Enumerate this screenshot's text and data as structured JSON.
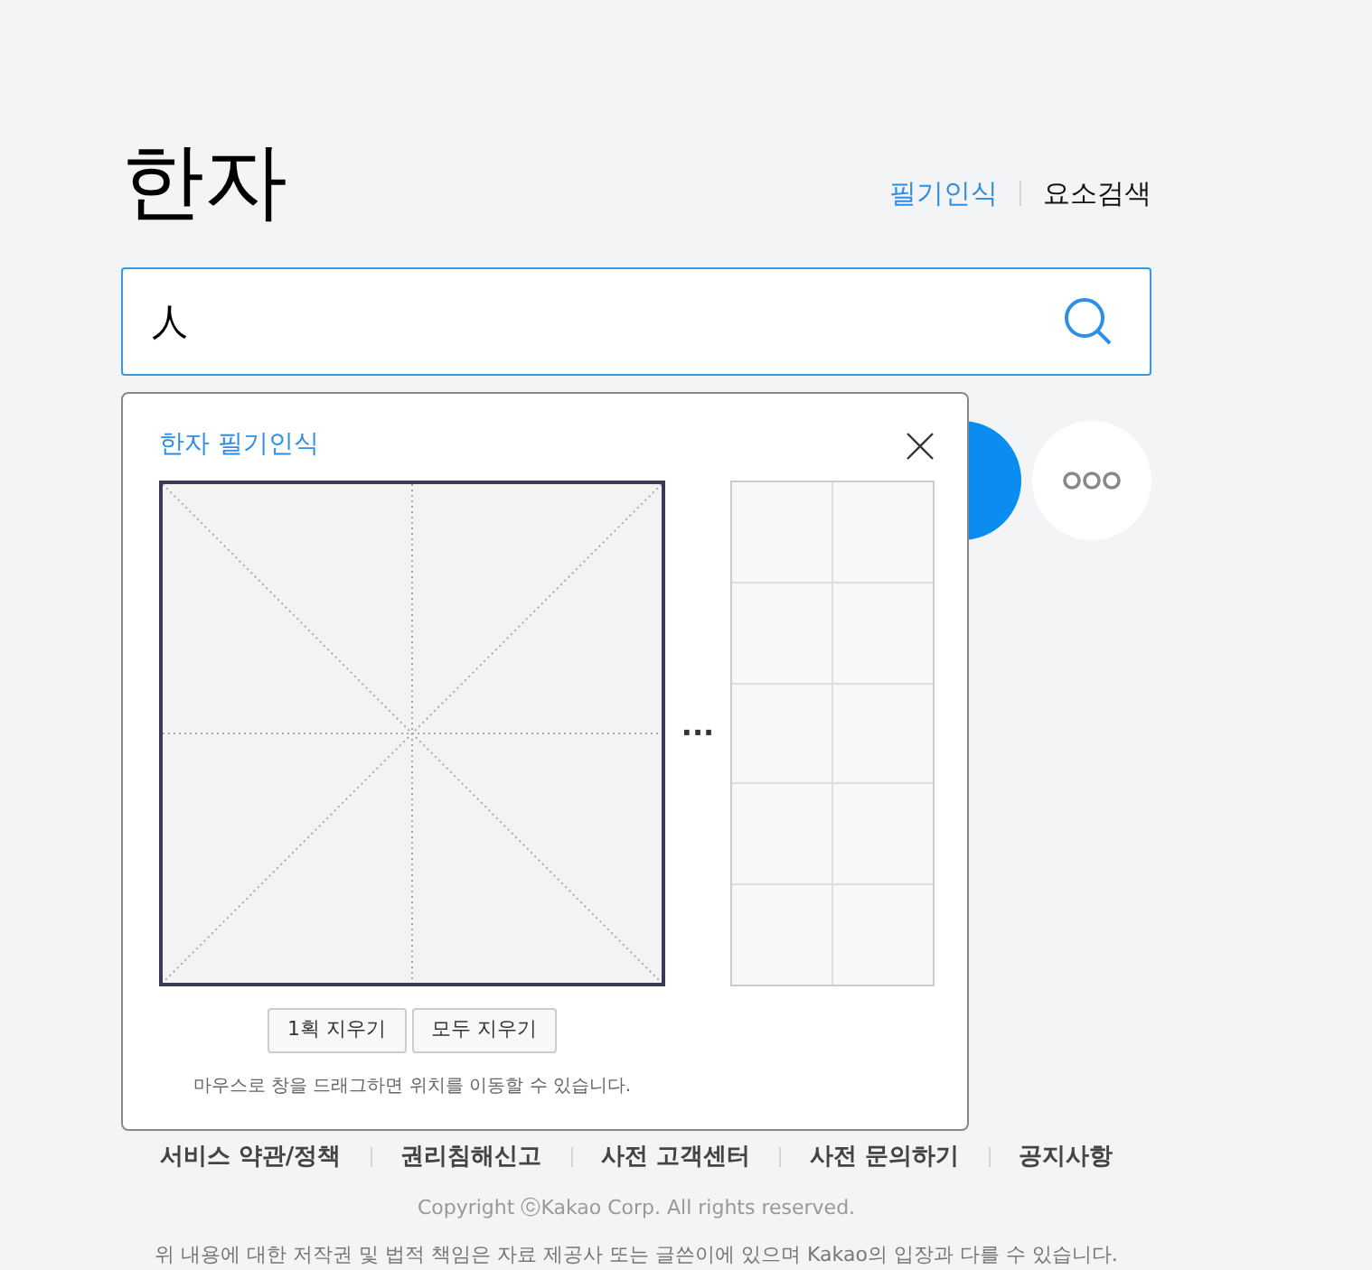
{
  "title": "한자",
  "modes": [
    {
      "label": "필기인식",
      "selected": true
    },
    {
      "label": "요소검색",
      "selected": false
    }
  ],
  "search": {
    "value": "人"
  },
  "handwriting_panel": {
    "title": "한자 필기인식",
    "more": "···",
    "buttons": [
      "1획 지우기",
      "모두 지우기"
    ],
    "hint": "마우스로 창을 드래그하면 위치를 이동할 수 있습니다."
  },
  "footer": {
    "links": [
      "서비스 약관/정책",
      "권리침해신고",
      "사전 고객센터",
      "사전 문의하기",
      "공지사항"
    ],
    "copyright": "Copyright ⓒKakao Corp. All rights reserved.",
    "disclaimer": "위 내용에 대한 저작권 및 법적 책임은 자료 제공사 또는 글쓴이에 있으며 Kakao의 입장과 다를 수 있습니다."
  }
}
